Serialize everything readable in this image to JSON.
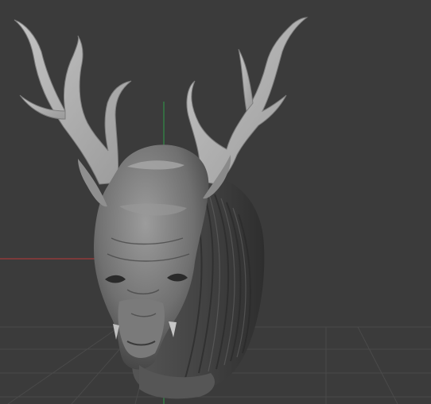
{
  "viewport": {
    "background_color": "#3b3b3b",
    "grid_color": "#555555",
    "axis_x_color": "#b43c3c",
    "axis_y_color": "#2f9c4a"
  },
  "model": {
    "subject": "stag-dragon-head-sculpt",
    "material_color": "#8a8a8a",
    "highlight_color": "#b9b9b9",
    "shadow_color": "#2c2c2c"
  }
}
